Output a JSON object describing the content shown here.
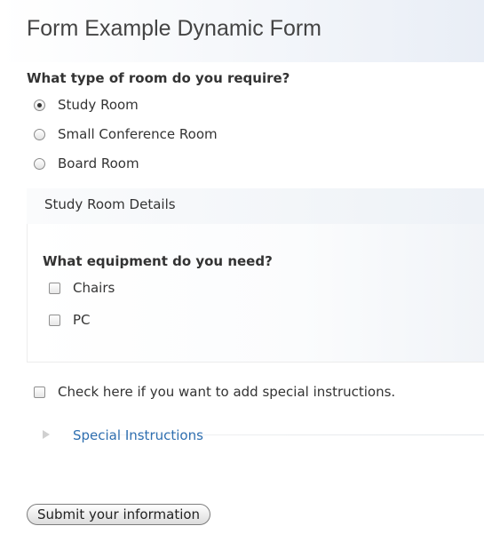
{
  "form": {
    "title": "Form Example Dynamic Form",
    "room_question": "What type of room do you require?",
    "room_options": [
      {
        "label": "Study Room",
        "selected": true
      },
      {
        "label": "Small Conference Room",
        "selected": false
      },
      {
        "label": "Board Room",
        "selected": false
      }
    ],
    "details_legend": "Study Room Details",
    "equipment_question": "What equipment do you need?",
    "equipment_options": [
      {
        "label": "Chairs",
        "checked": false
      },
      {
        "label": "PC",
        "checked": false
      }
    ],
    "special_checkbox_label": "Check here if you want to add special instructions.",
    "special_checkbox_checked": false,
    "special_link": "Special Instructions",
    "submit_label": "Submit your information"
  },
  "colors": {
    "link": "#2f6fb0",
    "text": "#333333",
    "title": "#444444"
  },
  "icons": {
    "special_instructions": "triangle-right-icon"
  }
}
